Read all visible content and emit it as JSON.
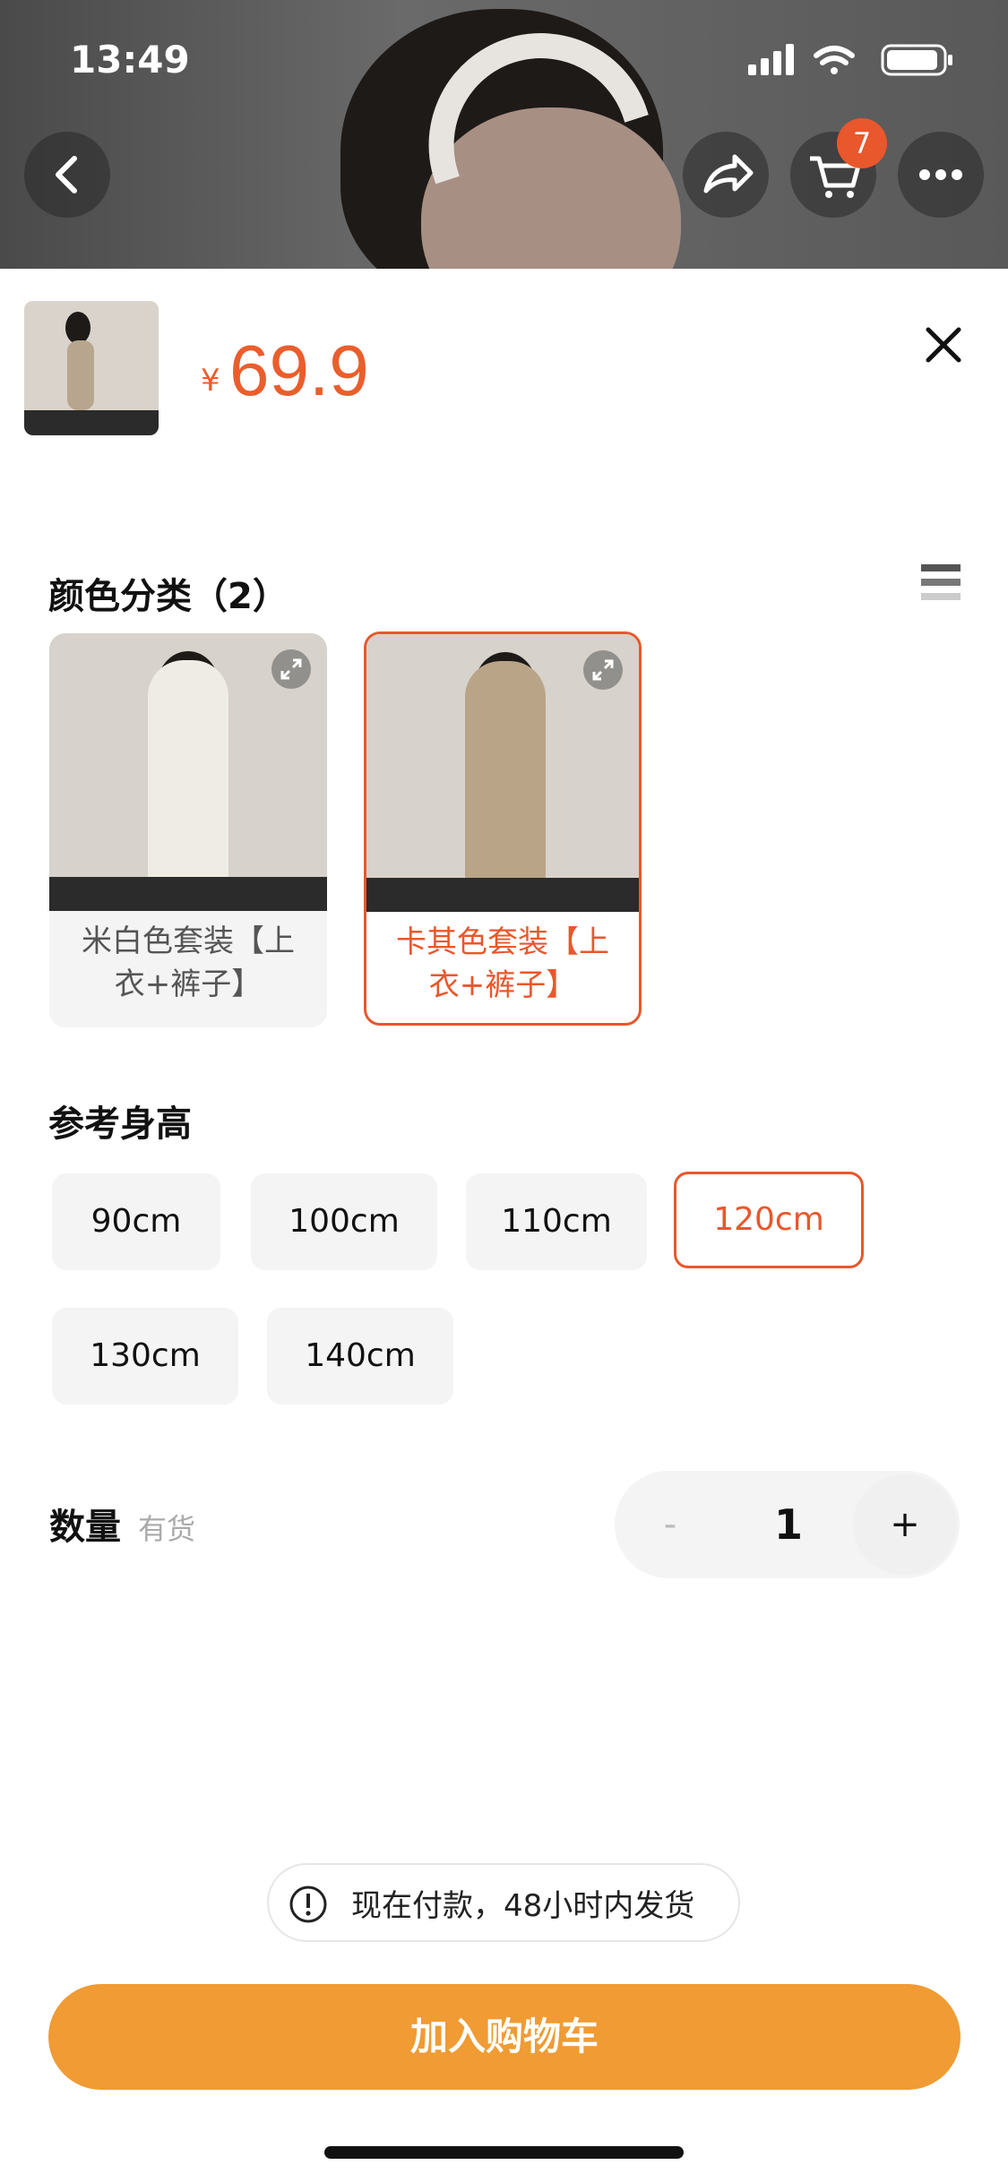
{
  "status_bar": {
    "time": "13:49"
  },
  "nav": {
    "cart_count": "7"
  },
  "product": {
    "currency": "¥",
    "price": "69.9"
  },
  "color_section": {
    "title": "颜色分类（2）",
    "options": [
      {
        "label": "米白色套装【上衣+裤子】",
        "selected": false
      },
      {
        "label": "卡其色套装【上衣+裤子】",
        "selected": true
      }
    ]
  },
  "size_section": {
    "title": "参考身高",
    "options": [
      "90cm",
      "100cm",
      "110cm",
      "120cm",
      "130cm",
      "140cm"
    ],
    "selected": "120cm"
  },
  "quantity": {
    "label": "数量",
    "stock": "有货",
    "minus": "-",
    "value": "1",
    "plus": "+"
  },
  "notice": {
    "text": "现在付款，48小时内发货"
  },
  "actions": {
    "add_to_cart": "加入购物车"
  },
  "colors": {
    "accent": "#e9572c",
    "cart_button": "#f09b33"
  }
}
